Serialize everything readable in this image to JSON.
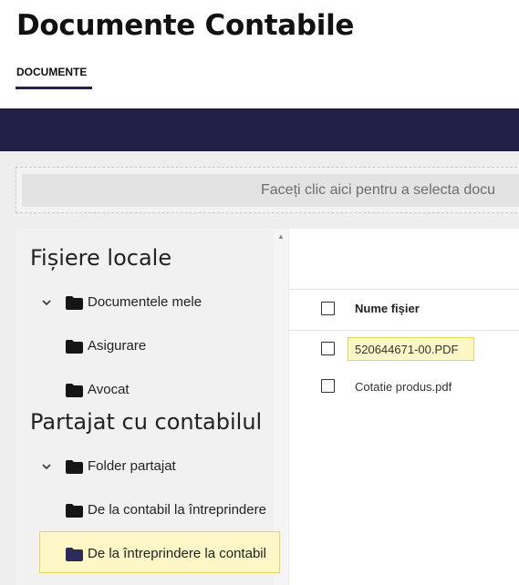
{
  "header": {
    "title": "Documente Contabile",
    "tab_label": "DOCUMENTE"
  },
  "dropzone": {
    "text": "Faceți clic aici pentru a selecta docu"
  },
  "sidebar": {
    "local_title": "Fișiere locale",
    "local_items": [
      {
        "label": "Documentele mele",
        "expanded": true
      },
      {
        "label": "Asigurare"
      },
      {
        "label": "Avocat"
      }
    ],
    "shared_title": "Partajat cu contabilul",
    "shared_items": [
      {
        "label": "Folder partajat",
        "expanded": true
      },
      {
        "label": "De la contabil la întreprindere"
      },
      {
        "label": "De la întreprindere la contabil",
        "selected": true
      }
    ]
  },
  "files": {
    "column_name": "Nume fișier",
    "rows": [
      {
        "name": "520644671-00.PDF",
        "highlighted": true
      },
      {
        "name": "Cotatie produs.pdf"
      }
    ]
  },
  "colors": {
    "navbar": "#211f45",
    "tab_underline": "#24214f",
    "highlight_fill": "#fdf7c8",
    "highlight_border": "#e2d463",
    "selected_folder": "#2b2a5a"
  },
  "icons": [
    "chevron-down-icon",
    "folder-icon",
    "scroll-up-arrow-icon"
  ]
}
